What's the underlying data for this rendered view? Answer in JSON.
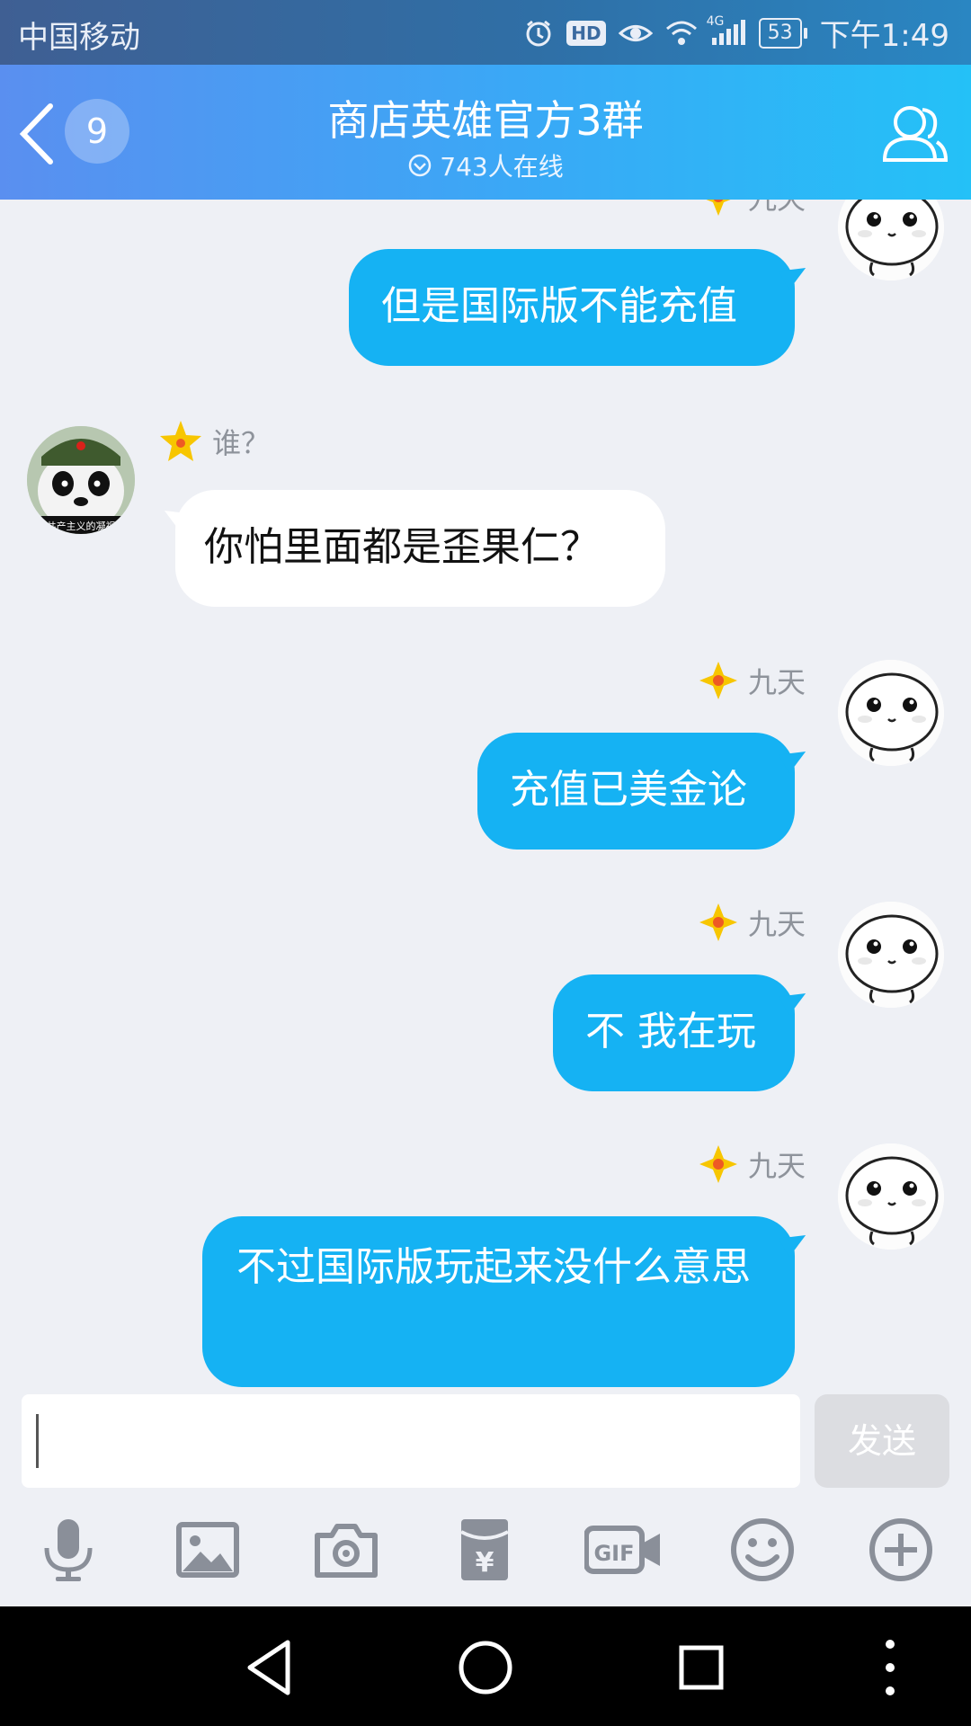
{
  "status_bar": {
    "carrier": "中国移动",
    "hd": "HD",
    "network": "4G",
    "battery": "53",
    "time": "下午1:49"
  },
  "header": {
    "unread_count": "9",
    "title": "商店英雄官方3群",
    "online": "743人在线"
  },
  "messages": [
    {
      "side": "right",
      "sender": "九天",
      "text": "但是国际版不能充值"
    },
    {
      "side": "left",
      "sender": "谁？",
      "text": "你怕里面都是歪果仁？"
    },
    {
      "side": "right",
      "sender": "九天",
      "text": "充值已美金论"
    },
    {
      "side": "right",
      "sender": "九天",
      "text": "不 我在玩"
    },
    {
      "side": "right",
      "sender": "九天",
      "text": "不过国际版玩起来没什么意思"
    }
  ],
  "panda_avatar_caption": "共产主义的凝视",
  "input": {
    "value": "",
    "send_label": "发送"
  },
  "toolbar": {
    "items": [
      "microphone-icon",
      "image-icon",
      "camera-icon",
      "red-packet-icon",
      "gif-icon",
      "emoji-icon",
      "plus-icon"
    ]
  },
  "colors": {
    "bubble_out": "#15b2f3",
    "bubble_in": "#ffffff",
    "header_start": "#5a8ff0",
    "header_end": "#24c1f7",
    "background": "#eef0f5",
    "sender_star": "#f7c600"
  }
}
